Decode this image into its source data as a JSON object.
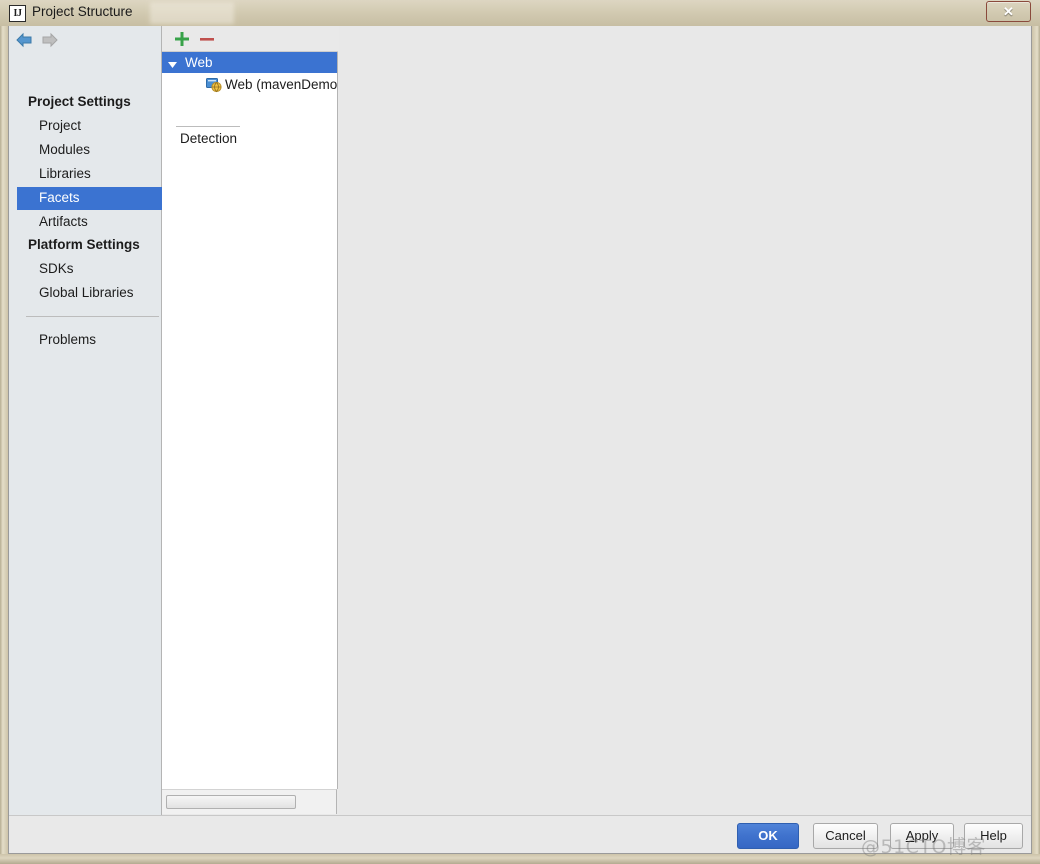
{
  "window": {
    "title": "Project Structure",
    "app_icon": "intellij-idea-icon",
    "close_label": "✕"
  },
  "sidebar": {
    "nav": {
      "back_icon": "arrow-left-icon",
      "forward_icon": "arrow-right-icon"
    },
    "groups": [
      {
        "title": "Project Settings",
        "items": [
          {
            "label": "Project",
            "selected": false
          },
          {
            "label": "Modules",
            "selected": false
          },
          {
            "label": "Libraries",
            "selected": false
          },
          {
            "label": "Facets",
            "selected": true
          },
          {
            "label": "Artifacts",
            "selected": false
          }
        ]
      },
      {
        "title": "Platform Settings",
        "items": [
          {
            "label": "SDKs",
            "selected": false
          },
          {
            "label": "Global Libraries",
            "selected": false
          }
        ]
      }
    ],
    "problems": {
      "label": "Problems",
      "selected": false
    }
  },
  "tree_panel": {
    "toolbar": {
      "add_icon": "plus-icon",
      "add_color": "#38a249",
      "remove_icon": "minus-icon",
      "remove_color": "#c0504d"
    },
    "root": {
      "label": "Web",
      "expanded": true,
      "selected": true,
      "toggle_icon": "triangle-down-icon"
    },
    "child": {
      "label": "Web (mavenDemo_",
      "icon": "web-facet-icon"
    },
    "section_label": "Detection",
    "scrollbar": {
      "orientation": "horizontal",
      "thumb_fraction": 0.74
    }
  },
  "buttons": {
    "ok": "OK",
    "cancel": "Cancel",
    "apply_prefix": "A",
    "apply_suffix": "pply",
    "help": "Help"
  },
  "watermark": {
    "text": "@51CTO博客"
  },
  "colors": {
    "selection_blue": "#3b73d1",
    "sidebar_bg": "#e4e8eb",
    "panel_bg": "#e8e8e8",
    "frame_beige": "#cfc6ab",
    "close_red": "#cf4a38"
  }
}
